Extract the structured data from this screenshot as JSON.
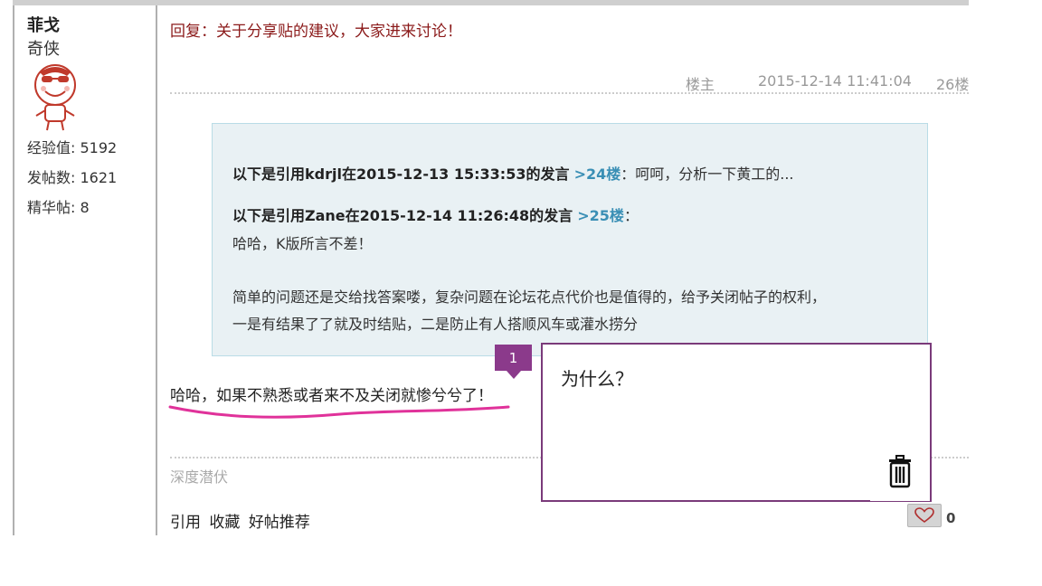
{
  "user": {
    "name": "菲戈",
    "rank": "奇侠",
    "stats": [
      "经验值: 5192",
      "发帖数: 1621",
      "精华帖: 8"
    ]
  },
  "post": {
    "title": "回复：关于分享贴的建议，大家进来讨论！",
    "role": "楼主",
    "datetime": "2015-12-14 11:41:04",
    "floor": "26楼"
  },
  "quote": {
    "line1_prefix": "以下是引用kdrjl在2015-12-13 15:33:53的发言",
    "line1_link": ">24楼",
    "line1_text": "：呵呵，分析一下黄工的...",
    "line2_prefix": "以下是引用Zane在2015-12-14 11:26:48的发言",
    "line2_link": ">25楼",
    "line2_text": "：",
    "line3": "哈哈，K版所言不差！",
    "line4": "简单的问题还是交给找答案喽，复杂问题在论坛花点代价也是值得的，给予关闭帖子的权利，",
    "line5": "一是有结果了了就及时结贴，二是防止有人搭顺风车或灌水捞分"
  },
  "reply_text": "哈哈，如果不熟悉或者来不及关闭就惨兮兮了！",
  "signature": "深度潜伏",
  "actions": [
    "引用",
    "收藏",
    "好帖推荐"
  ],
  "like_count": "0",
  "annotation": {
    "badge": "1",
    "comment": "为什么？"
  },
  "icons": {
    "heart": "heart-icon",
    "trash": "trash-icon"
  },
  "colors": {
    "title": "#8b1a1a",
    "link": "#3a8fb5",
    "annotation": "#8b3a8b",
    "highlight": "#e0329a"
  }
}
